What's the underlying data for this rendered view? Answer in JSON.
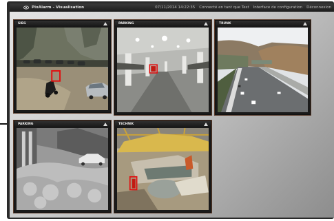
{
  "window": {
    "title": "PixAlarm - Visualisation",
    "datetime": "07/11/2014 14:22:35",
    "user_status": "Connecté en tant que Test",
    "config_link": "Interface de configuration",
    "logout_link": "Déconnexion"
  },
  "cameras": [
    {
      "label": "SIEG",
      "scene": "courtyard"
    },
    {
      "label": "PARKING",
      "scene": "parking-garage"
    },
    {
      "label": "TRUNK",
      "scene": "highway"
    },
    {
      "label": "PARKING",
      "scene": "garden"
    },
    {
      "label": "TECHNIK",
      "scene": "factory"
    }
  ],
  "icons": {
    "app": "eye-icon",
    "expand": "expand-icon"
  },
  "colors": {
    "detection_box": "#e01010",
    "tile_border": "#5a3b2a",
    "header": "#1e1e1e"
  }
}
